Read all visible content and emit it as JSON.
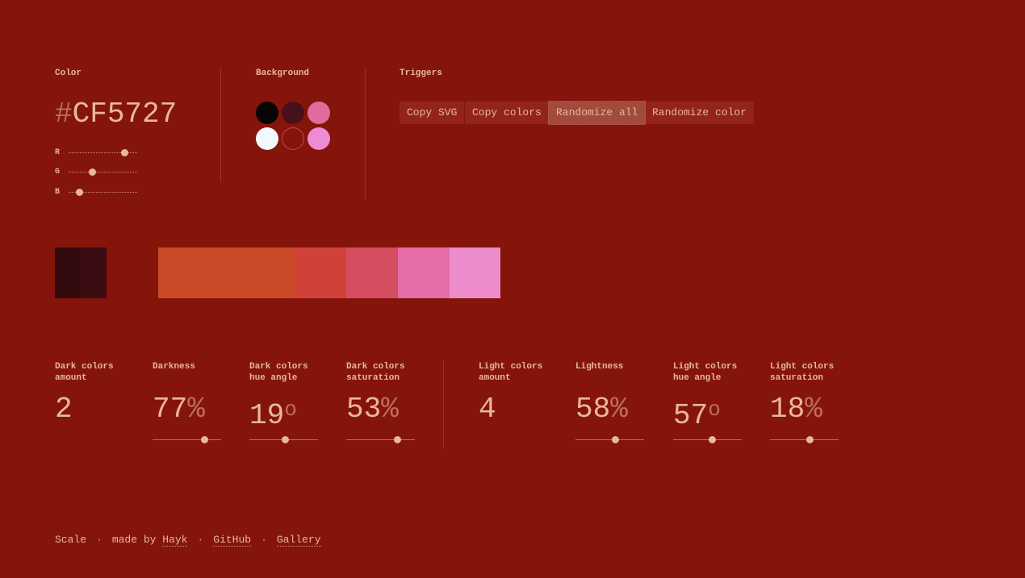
{
  "color": {
    "label": "Color",
    "hash": "#",
    "hex": "CF5727",
    "channels": [
      {
        "name": "R",
        "value": 207
      },
      {
        "name": "G",
        "value": 87
      },
      {
        "name": "B",
        "value": 39
      }
    ]
  },
  "background": {
    "label": "Background",
    "swatches": [
      "#080506",
      "#47101a",
      "#e06c9e",
      "#f1f9ff",
      "#85150b",
      "#ed8bd3"
    ],
    "selected_index": 4
  },
  "triggers": {
    "label": "Triggers",
    "buttons": [
      {
        "label": "Copy SVG"
      },
      {
        "label": "Copy colors"
      },
      {
        "label": "Randomize all"
      },
      {
        "label": "Randomize color"
      }
    ],
    "active_index": 2
  },
  "scale": {
    "dark": [
      "#320a0d",
      "#3a0c11"
    ],
    "main": "#c94a26",
    "light": [
      "#d0413a",
      "#d54d60",
      "#e56ca6",
      "#ec8ccb"
    ]
  },
  "params": [
    {
      "label1": "Dark colors",
      "label2": "amount",
      "value": "2",
      "unit": ""
    },
    {
      "label1": "Darkness",
      "label2": "",
      "value": "77",
      "unit": "%",
      "slider": 0.75
    },
    {
      "label1": "Dark colors",
      "label2": "hue angle",
      "value": "19",
      "unit": "o",
      "slider": 0.52
    },
    {
      "label1": "Dark colors",
      "label2": "saturation",
      "value": "53",
      "unit": "%",
      "slider": 0.74
    },
    {
      "label1": "Light colors",
      "label2": "amount",
      "value": "4",
      "unit": ""
    },
    {
      "label1": "Lightness",
      "label2": "",
      "value": "58",
      "unit": "%",
      "slider": 0.58
    },
    {
      "label1": "Light colors",
      "label2": "hue angle",
      "value": "57",
      "unit": "o",
      "slider": 0.57
    },
    {
      "label1": "Light colors",
      "label2": "saturation",
      "value": "18",
      "unit": "%",
      "slider": 0.58
    }
  ],
  "footer": {
    "app": "Scale",
    "dot": "·",
    "made_by": "made by",
    "author": "Hayk",
    "github": "GitHub",
    "gallery": "Gallery"
  }
}
